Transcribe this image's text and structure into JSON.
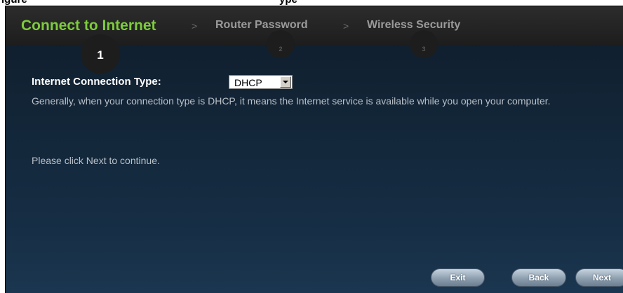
{
  "figure_caption": {
    "left": "igure",
    "right": "ype"
  },
  "wizard": {
    "steps": [
      {
        "label": "Connect to Internet",
        "number": "1",
        "state": "active"
      },
      {
        "label": "Router Password",
        "number": "2",
        "state": "inactive"
      },
      {
        "label": "Wireless Security",
        "number": "3",
        "state": "inactive"
      }
    ],
    "separator": ">",
    "colors": {
      "active_step": "#7dcc3c",
      "inactive_step": "#9a9a9a",
      "background": "#13273a"
    }
  },
  "form": {
    "connection_type_label": "Internet Connection Type:",
    "connection_type_value": "DHCP",
    "description": "Generally, when your connection type is DHCP, it means the Internet service is available while you open your computer.",
    "continue_text": "Please click Next to continue."
  },
  "buttons": {
    "exit": "Exit",
    "back": "Back",
    "next": "Next"
  }
}
